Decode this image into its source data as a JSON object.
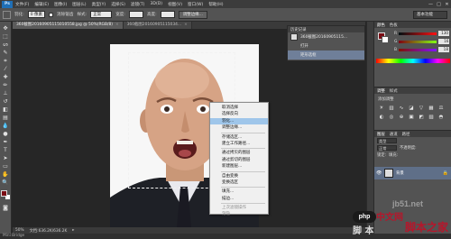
{
  "app": {
    "logo": "Ps"
  },
  "menu": [
    "文件(F)",
    "编辑(E)",
    "图像(I)",
    "图层(L)",
    "类型(Y)",
    "选择(S)",
    "滤镜(T)",
    "3D(D)",
    "视图(V)",
    "窗口(W)",
    "帮助(H)"
  ],
  "window_controls": [
    "—",
    "□",
    "✕"
  ],
  "options": {
    "feather_label": "羽化:",
    "feather_value": "0 像素",
    "antialias_label": "消除锯齿",
    "style_label": "样式:",
    "style_value": "正常",
    "width_label": "宽度:",
    "height_label": "高度:",
    "refine_edge": "调整边缘...",
    "workspace": "基本功能"
  },
  "tabs": [
    {
      "label": "360截图20160905115010558.jpg @ 50%(RGB/8)",
      "active": true
    },
    {
      "label": "360截图20160905115034...",
      "active": false
    }
  ],
  "history": {
    "title": "历史记录",
    "items": [
      {
        "label": "360截图20160905115...",
        "selected": false
      },
      {
        "label": "打开",
        "selected": false
      },
      {
        "label": "矩形选框",
        "selected": true
      }
    ]
  },
  "context_menu": [
    {
      "label": "取消选择",
      "state": "normal"
    },
    {
      "label": "选择反向",
      "state": "normal"
    },
    {
      "label": "羽化...",
      "state": "selected"
    },
    {
      "label": "调整边缘...",
      "state": "normal"
    },
    {
      "sep": true
    },
    {
      "label": "存储选区...",
      "state": "normal"
    },
    {
      "label": "建立工作路径...",
      "state": "normal"
    },
    {
      "sep": true
    },
    {
      "label": "通过拷贝的图层",
      "state": "normal"
    },
    {
      "label": "通过剪切的图层",
      "state": "normal"
    },
    {
      "label": "新建图层...",
      "state": "normal"
    },
    {
      "sep": true
    },
    {
      "label": "自由变换",
      "state": "normal"
    },
    {
      "label": "变换选区",
      "state": "normal"
    },
    {
      "sep": true
    },
    {
      "label": "填充...",
      "state": "normal"
    },
    {
      "label": "描边...",
      "state": "normal"
    },
    {
      "sep": true
    },
    {
      "label": "上次滤镜操作",
      "state": "disabled"
    },
    {
      "label": "渐隐...",
      "state": "disabled"
    }
  ],
  "color_panel": {
    "tabs": [
      "颜色",
      "色板"
    ],
    "r": "130",
    "g": "16",
    "b": "18",
    "fg": "#7a0c14"
  },
  "adjustments": {
    "tabs": [
      "调整",
      "样式"
    ],
    "title": "添加调整"
  },
  "layers": {
    "tabs": [
      "图层",
      "通道",
      "路径"
    ],
    "kind_label": "类型",
    "blend_mode": "正常",
    "opacity_label": "不透明度:",
    "lock_label": "锁定:",
    "fill_label": "填充:",
    "layer_name": "背景"
  },
  "status": {
    "zoom": "50%",
    "doc": "文档:636.2K/636.2K"
  },
  "bottom_bar": "Mini Bridge",
  "watermark": {
    "site": "jb51.net",
    "php": "php",
    "cn": "中文网",
    "big": "脚本之家",
    "left": "脚 本"
  }
}
